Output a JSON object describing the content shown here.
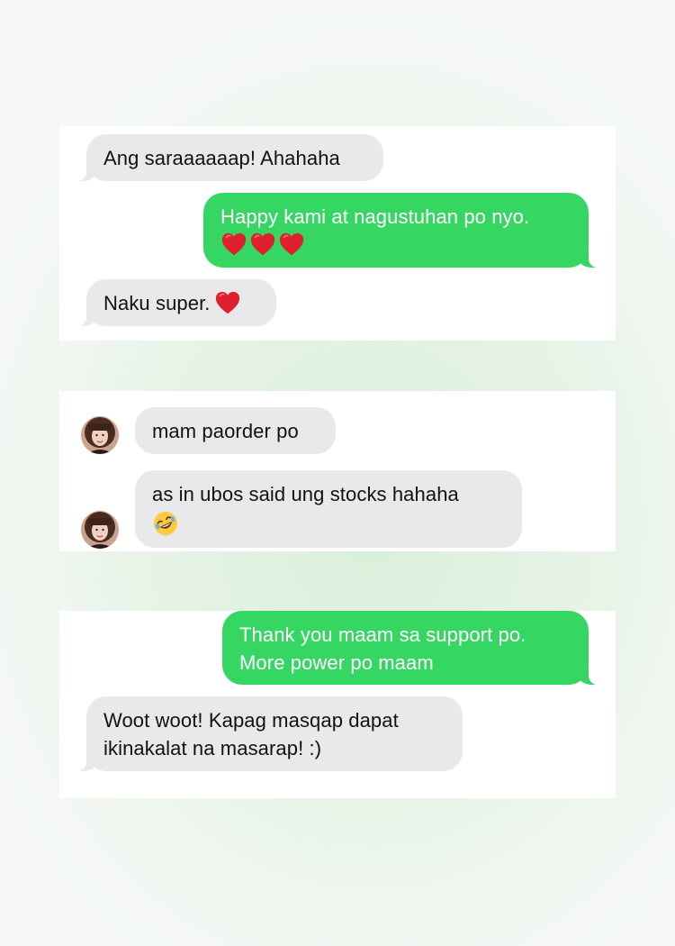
{
  "panel1": {
    "msg1": "Ang saraaaaaap! Ahahaha",
    "msg2": "Happy kami at nagustuhan po nyo.",
    "msg2_emoji": [
      "heart-emoji",
      "heart-emoji",
      "heart-emoji"
    ],
    "msg3": "Naku super."
  },
  "panel2": {
    "msg1": "mam paorder po",
    "msg2": "as in ubos said ung stocks hahaha",
    "msg2_emoji": "rolling-on-floor-laughing-emoji"
  },
  "panel3": {
    "msg1_line1": "Thank you maam sa support po.",
    "msg1_line2": "More power po maam",
    "msg2_line1": "Woot woot! Kapag masqap dapat",
    "msg2_line2": "ikinakalat na masarap! :)"
  },
  "colors": {
    "sent_bubble": "#36d662",
    "received_bubble": "#e9e9eb",
    "heart": "#e0202f"
  }
}
